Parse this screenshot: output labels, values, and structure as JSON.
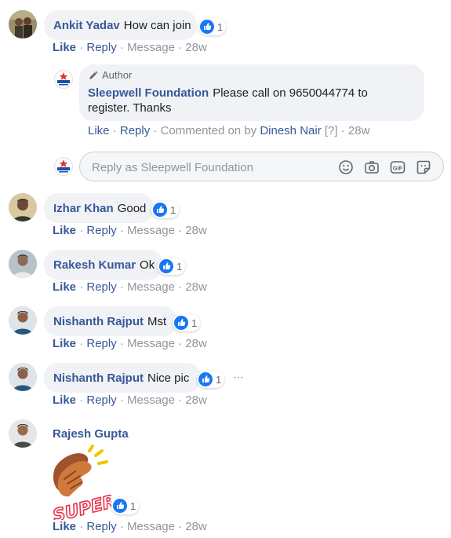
{
  "colors": {
    "link": "#385898",
    "like_blue": "#1877f2",
    "meta_gray": "#90949c",
    "bubble_bg": "#f0f2f5"
  },
  "separator": "·",
  "comments": [
    {
      "author": "Ankit Yadav",
      "text": "How can join",
      "reactions": "1",
      "like": "Like",
      "reply": "Reply",
      "message": "Message",
      "time": "28w"
    },
    {
      "author": "Izhar Khan",
      "text": "Good",
      "reactions": "1",
      "like": "Like",
      "reply": "Reply",
      "message": "Message",
      "time": "28w"
    },
    {
      "author": "Rakesh Kumar",
      "text": "Ok",
      "reactions": "1",
      "like": "Like",
      "reply": "Reply",
      "message": "Message",
      "time": "28w"
    },
    {
      "author": "Nishanth Rajput",
      "text": "Mst",
      "reactions": "1",
      "like": "Like",
      "reply": "Reply",
      "message": "Message",
      "time": "28w"
    },
    {
      "author": "Nishanth Rajput",
      "text": "Nice pic",
      "reactions": "1",
      "like": "Like",
      "reply": "Reply",
      "message": "Message",
      "time": "28w"
    },
    {
      "author": "Rajesh Gupta",
      "sticker": "SUPER!",
      "reactions": "1",
      "like": "Like",
      "reply": "Reply",
      "message": "Message",
      "time": "28w"
    }
  ],
  "author_reply": {
    "badge": "Author",
    "author": "Sleepwell Foundation",
    "text_line1": "Please call on 9650044774 to",
    "text_line2": "register. Thanks",
    "like": "Like",
    "reply": "Reply",
    "commented_on_by": "Commented on by",
    "commenter": "Dinesh Nair",
    "help": "[?]",
    "time": "28w",
    "logo_text": "Sleepwell"
  },
  "reply_box": {
    "placeholder": "Reply as Sleepwell Foundation",
    "icons": [
      "emoji-icon",
      "camera-icon",
      "gif-icon",
      "sticker-icon"
    ]
  },
  "more_options": "···"
}
